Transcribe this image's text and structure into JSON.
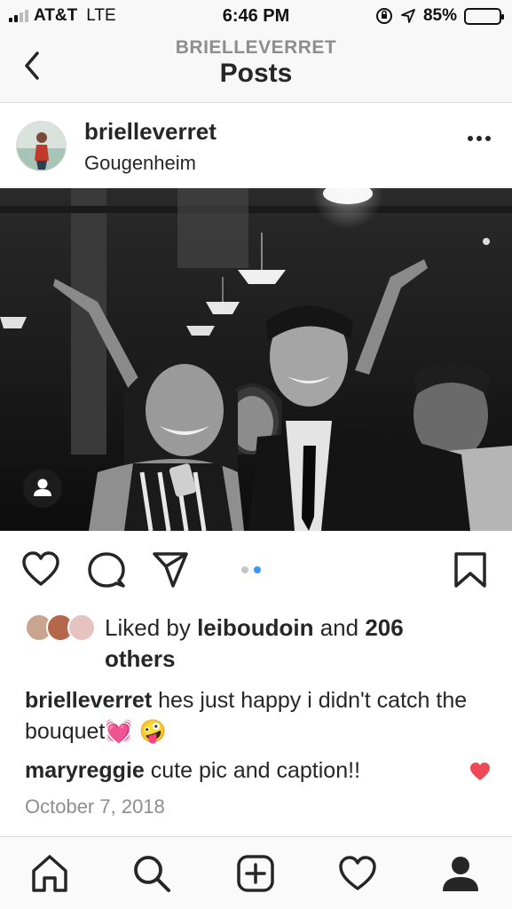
{
  "status_bar": {
    "carrier": "AT&T",
    "network": "LTE",
    "time": "6:46 PM",
    "battery": "85%",
    "battery_level": 0.85
  },
  "header": {
    "subtitle": "BRIELLEVERRET",
    "title": "Posts"
  },
  "post": {
    "username": "brielleverret",
    "location": "Gougenheim",
    "carousel": {
      "count": 2,
      "active_index": 1,
      "active_color": "#3897f0",
      "inactive_color": "#c7c7c7"
    },
    "likes": {
      "prefix": "Liked by ",
      "user": "leiboudoin",
      "middle": " and ",
      "count": "206",
      "suffix": " others"
    },
    "caption": {
      "user": "brielleverret",
      "text": " hes just happy i didn't catch the bouquet💓 🤪"
    },
    "comment": {
      "user": "maryreggie",
      "text": " cute pic and caption!!",
      "liked": true,
      "heart_color": "#ed4956"
    },
    "date": "October 7, 2018"
  },
  "icons": {
    "back": "chevron-left-icon",
    "more": "more-icon",
    "like": "heart-icon",
    "comment": "comment-icon",
    "share": "paper-plane-icon",
    "save": "bookmark-icon",
    "tag": "person-tag-icon",
    "nav": [
      "home-icon",
      "search-icon",
      "add-post-icon",
      "activity-heart-icon",
      "profile-icon"
    ]
  }
}
